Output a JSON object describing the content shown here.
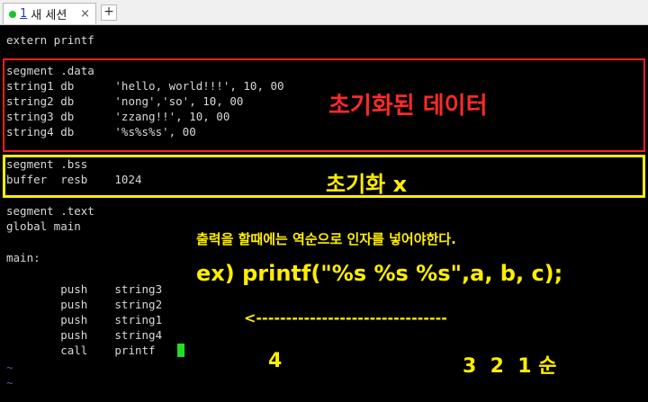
{
  "tab": {
    "number": "1",
    "title": "새 세션",
    "close_label": "×",
    "status_color": "#19c32a"
  },
  "new_tab_label": "+",
  "code_lines": [
    "extern printf",
    "",
    "segment .data",
    "string1 db      'hello, world!!!', 10, 00",
    "string2 db      'nong','so', 10, 00",
    "string3 db      'zzang!!', 10, 00",
    "string4 db      '%s%s%s', 00",
    "",
    "segment .bss",
    "buffer  resb    1024",
    "",
    "segment .text",
    "global main",
    "",
    "main:",
    "",
    "        push    string3",
    "        push    string2",
    "        push    string1",
    "        push    string4",
    "        call    printf",
    "~",
    "~"
  ],
  "annotations": {
    "data_label": "초기화된 데이터",
    "bss_label": "초기화 x",
    "note": "출력을 할때에는 역순으로 인자를 넣어야한다.",
    "example": "ex) printf(\"%s %s %s\",a, b, c);",
    "arrow": "<--------------------------------",
    "push_count": "4",
    "order": "3  2  1 순"
  },
  "colors": {
    "data_box": "#ff2020",
    "bss_box": "#ffee00",
    "annotation_yellow": "#ffee00",
    "annotation_red": "#ff2a2a",
    "cursor": "#22dd22"
  }
}
